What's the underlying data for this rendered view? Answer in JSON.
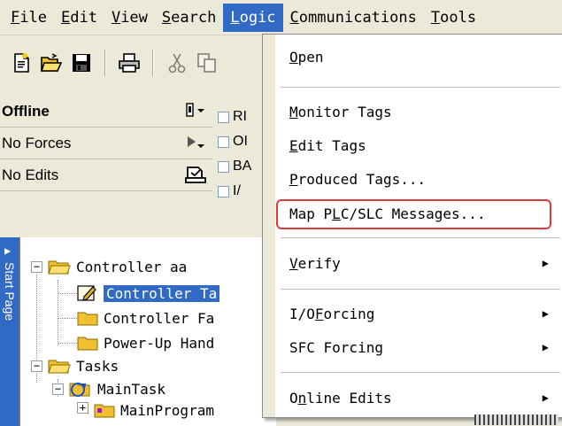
{
  "menubar": {
    "items": [
      {
        "hotkey": "F",
        "rest": "ile"
      },
      {
        "hotkey": "E",
        "rest": "dit"
      },
      {
        "hotkey": "V",
        "rest": "iew"
      },
      {
        "hotkey": "S",
        "rest": "earch"
      },
      {
        "hotkey": "L",
        "rest": "ogic"
      },
      {
        "hotkey": "C",
        "rest": "ommunications"
      },
      {
        "hotkey": "T",
        "rest": "ools"
      }
    ],
    "active_index": 4
  },
  "toolbar": {
    "icons": [
      "new-file-icon",
      "open-folder-icon",
      "save-disk-icon",
      "print-icon",
      "cut-icon",
      "copy-icon"
    ]
  },
  "status": {
    "mode": "Offline",
    "forces": "No Forces",
    "edits": "No Edits"
  },
  "checks": {
    "labels": [
      "RI",
      "OI",
      "BA",
      "I/"
    ]
  },
  "sidebar": {
    "start_page_label": "Start Page"
  },
  "tree": {
    "controller": "Controller aa",
    "controller_tags": "Controller Ta",
    "controller_fault": "Controller Fa",
    "powerup": "Power-Up Hand",
    "tasks": "Tasks",
    "main_task": "MainTask",
    "main_program": "MainProgram"
  },
  "dropdown": {
    "open": {
      "hotkey": "O",
      "rest": "pen"
    },
    "monitor_tags": {
      "hotkey": "M",
      "rest": "onitor Tags"
    },
    "edit_tags": {
      "hotkey": "E",
      "rest": "dit Tags"
    },
    "produced_tags": {
      "hotkey": "P",
      "rest": "roduced Tags..."
    },
    "map_plc": {
      "pre": "Map P",
      "hotkey": "L",
      "rest": "C/SLC Messages..."
    },
    "verify": {
      "hotkey": "V",
      "rest": "erify"
    },
    "io_forcing": {
      "pre": "I/O ",
      "hotkey": "F",
      "rest": "orcing"
    },
    "sfc_forcing": "SFC Forcing",
    "online_edits": {
      "pre": "O",
      "hotkey": "n",
      "rest": "line Edits"
    }
  },
  "colors": {
    "menu_highlight": "#316ac5",
    "callout_border": "#e03a3a",
    "window_bg": "#ece9d8"
  }
}
